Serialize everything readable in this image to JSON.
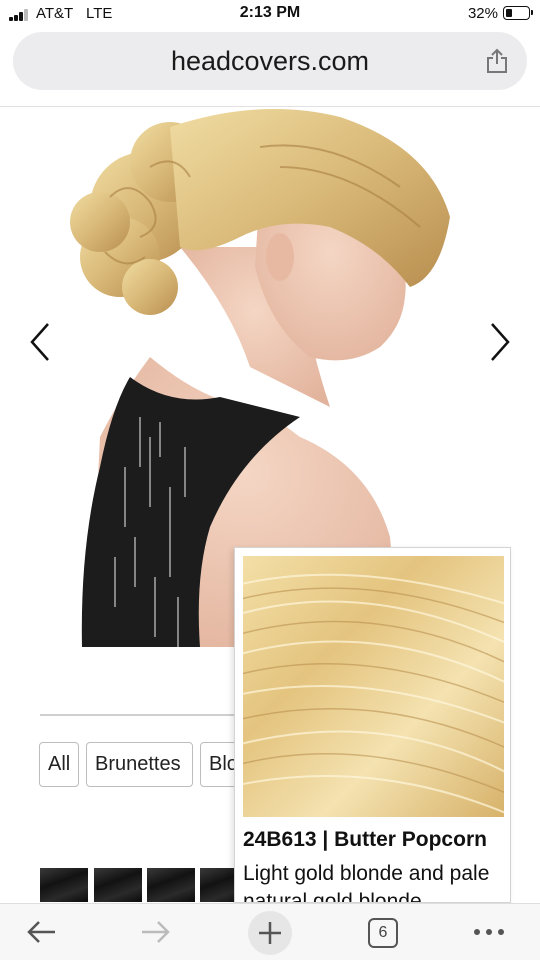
{
  "status_bar": {
    "carrier": "AT&T",
    "network": "LTE",
    "time": "2:13 PM",
    "battery": "32%",
    "battery_level": 0.32
  },
  "browser": {
    "url": "headcovers.com",
    "share_icon": "share-icon",
    "tab_count": "6",
    "toolbar_icons": [
      "back-arrow-icon",
      "forward-arrow-icon",
      "new-tab-plus-icon",
      "tabs-icon",
      "more-icon"
    ]
  },
  "product": {
    "image_icon": "hair-piece-model-photo",
    "prev_icon": "chevron-left-icon",
    "next_icon": "chevron-right-icon"
  },
  "filters": [
    "All",
    "Brunettes",
    "Blondes"
  ],
  "swatch_popup": {
    "title": "24B613 | Butter Popcorn",
    "description": "Light gold blonde and pale natural gold blonde"
  },
  "colors": {
    "url_bar_bg": "#ececee",
    "hair_blonde": "#e2c680",
    "top_black": "#1c1c1c"
  }
}
